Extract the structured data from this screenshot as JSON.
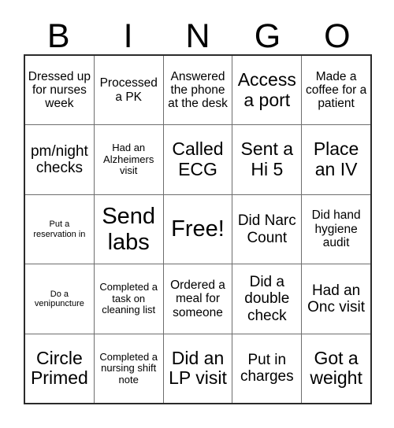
{
  "card": {
    "header_letters": [
      "B",
      "I",
      "N",
      "G",
      "O"
    ],
    "rows": [
      [
        {
          "text": "Dressed up for nurses week",
          "size": "m"
        },
        {
          "text": "Processed a PK",
          "size": "m"
        },
        {
          "text": "Answered the phone at the desk",
          "size": "m"
        },
        {
          "text": "Access a port",
          "size": "xl"
        },
        {
          "text": "Made a coffee for a patient",
          "size": "m"
        }
      ],
      [
        {
          "text": "pm/night checks",
          "size": "l"
        },
        {
          "text": "Had an Alzheimers visit",
          "size": "s"
        },
        {
          "text": "Called ECG",
          "size": "xl"
        },
        {
          "text": "Sent a Hi 5",
          "size": "xl"
        },
        {
          "text": "Place an IV",
          "size": "xl"
        }
      ],
      [
        {
          "text": "Put a reservation in",
          "size": "xs"
        },
        {
          "text": "Send labs",
          "size": "xxl"
        },
        {
          "text": "Free!",
          "size": "xxl"
        },
        {
          "text": "Did Narc Count",
          "size": "l"
        },
        {
          "text": "Did hand hygiene audit",
          "size": "m"
        }
      ],
      [
        {
          "text": "Do a venipuncture",
          "size": "xs"
        },
        {
          "text": "Completed a task on cleaning list",
          "size": "s"
        },
        {
          "text": "Ordered a meal for someone",
          "size": "m"
        },
        {
          "text": "Did a double check",
          "size": "l"
        },
        {
          "text": "Had an Onc visit",
          "size": "l"
        }
      ],
      [
        {
          "text": "Circle Primed",
          "size": "xl"
        },
        {
          "text": "Completed a nursing shift note",
          "size": "s"
        },
        {
          "text": "Did an LP visit",
          "size": "xl"
        },
        {
          "text": "Put in charges",
          "size": "l"
        },
        {
          "text": "Got a weight",
          "size": "xl"
        }
      ]
    ]
  },
  "colors": {
    "background": "#ffffff",
    "text": "#000000",
    "outer_border": "#2b2b2b",
    "inner_border": "#6e6e6e"
  }
}
